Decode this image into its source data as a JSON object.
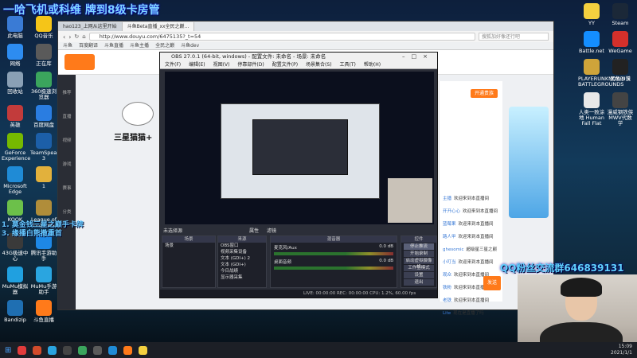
{
  "overlay": {
    "banner": "一哈飞机或科维 牌到8级卡房管",
    "notice_line1": "1. 莫金钱三星之巅手卡牌",
    "notice_line2": "3. 缘播白熊撒重首",
    "qq_banner": "QQ粉丝交流群646839131"
  },
  "desktop_icons_left": [
    {
      "label": "此电脑",
      "color": "#3a7bd5"
    },
    {
      "label": "QQ音乐",
      "color": "#f5c518"
    },
    {
      "label": "网络",
      "color": "#2d8cf0"
    },
    {
      "label": "正在库",
      "color": "#5a5a5a"
    },
    {
      "label": "回收站",
      "color": "#8aa0b5"
    },
    {
      "label": "360极速浏览器",
      "color": "#3ba55d"
    },
    {
      "label": "英雄",
      "color": "#c23b3b"
    },
    {
      "label": "百度网盘",
      "color": "#2a7de1"
    },
    {
      "label": "GeForce Experience",
      "color": "#76b900"
    },
    {
      "label": "TeamSpeak 3",
      "color": "#1c5fa8"
    },
    {
      "label": "Microsoft Edge",
      "color": "#1f8bd6"
    },
    {
      "label": "1",
      "color": "#e2b13c"
    },
    {
      "label": "KOOK",
      "color": "#6cc04a"
    },
    {
      "label": "League of Legends",
      "color": "#b08d3a"
    },
    {
      "label": "43G极速中心",
      "color": "#3a3a3a"
    },
    {
      "label": "腾讯手游助手",
      "color": "#1e88e5"
    },
    {
      "label": "MuMu模拟器",
      "color": "#20a0e0"
    },
    {
      "label": "MuMu手游助手",
      "color": "#2aa5e0"
    },
    {
      "label": "Bandizip",
      "color": "#1f6fb2"
    },
    {
      "label": "斗鱼直播",
      "color": "#ff7a1a"
    }
  ],
  "desktop_icons_right": [
    {
      "label": "YY",
      "color": "#f4d03f"
    },
    {
      "label": "Steam",
      "color": "#1b2838"
    },
    {
      "label": "Battle.net",
      "color": "#148eff"
    },
    {
      "label": "WeGame",
      "color": "#d4302b"
    },
    {
      "label": "PLAYERUNKNOWN'S BATTLEGROUNDS",
      "color": "#cfa43a"
    },
    {
      "label": "黑色沙漠",
      "color": "#222"
    },
    {
      "label": "人类一败涂地 Human Fall Flat",
      "color": "#e8e8e8"
    },
    {
      "label": "漫威钢铁侠 MWV代数学",
      "color": "#444"
    }
  ],
  "browser": {
    "tabs": [
      "hao123_上网从这里开始",
      "斗鱼Beta直播_xx全民之巅..."
    ],
    "url": "http://www.douyu.com/6475135?_t=54",
    "search_placeholder": "搜狐加好像还行吧",
    "bookmarks": [
      "斗鱼",
      "百度翻译",
      "斗鱼直播",
      "斗鱼主播",
      "全民之巅",
      "斗鱼dev"
    ],
    "site_side": [
      "推荐",
      "直播",
      "视频",
      "游戏",
      "赛事",
      "分类"
    ],
    "stream_title": "三星猫猫+",
    "follow_label": "开通贵族",
    "send_label": "发送",
    "chat": [
      {
        "user": "主播",
        "text": "欢迎来到本直播间"
      },
      {
        "user": "开开心心",
        "text": "欢迎来到本直播间"
      },
      {
        "user": "蓝莓果",
        "text": "欢迎来到本直播间"
      },
      {
        "user": "路人甲",
        "text": "欢迎来到本直播间"
      },
      {
        "user": "ghesomic",
        "text": "超级星三星之巅"
      },
      {
        "user": "小叮当",
        "text": "欢迎来到本直播间"
      },
      {
        "user": "观众",
        "text": "欢迎来到本直播间"
      },
      {
        "user": "铁粉",
        "text": "欢迎来到本直播间"
      },
      {
        "user": "老铁",
        "text": "欢迎来到本直播间"
      },
      {
        "user": "Lite",
        "text": "现在是直播了吗"
      }
    ]
  },
  "obs": {
    "title": "OBS 27.0.1 (64-bit, windows) - 配置文件: 未命名 - 场景: 未命名",
    "menu": [
      "文件(F)",
      "编辑(E)",
      "视图(V)",
      "停靠部件(D)",
      "配置文件(P)",
      "场景集合(S)",
      "工具(T)",
      "帮助(H)"
    ],
    "no_source_label": "未选择源",
    "properties_label": "属性",
    "filters_label": "滤镜",
    "panels": {
      "scenes": "场景",
      "sources": "来源",
      "mixer": "混音器",
      "controls": "控件"
    },
    "scene_item": "场景",
    "sources": [
      "OBS窗口",
      "视频采集设备",
      "文本 (GDI+) 2",
      "文本 (GDI+)",
      "今日战绩",
      "显示器采集"
    ],
    "mixer": [
      {
        "name": "麦克风/Aux",
        "db": "0.0 dB"
      },
      {
        "name": "桌面音频",
        "db": "0.0 dB"
      }
    ],
    "controls": [
      "停止推流",
      "开始录制",
      "启动虚拟摄像机",
      "工作室模式",
      "设置",
      "退出"
    ],
    "status": "LIVE: 00:00:00   REC: 00:00:00   CPU: 1.2%, 60.00 fps"
  },
  "taskbar": {
    "time": "15:09",
    "date": "2021/1/1"
  }
}
